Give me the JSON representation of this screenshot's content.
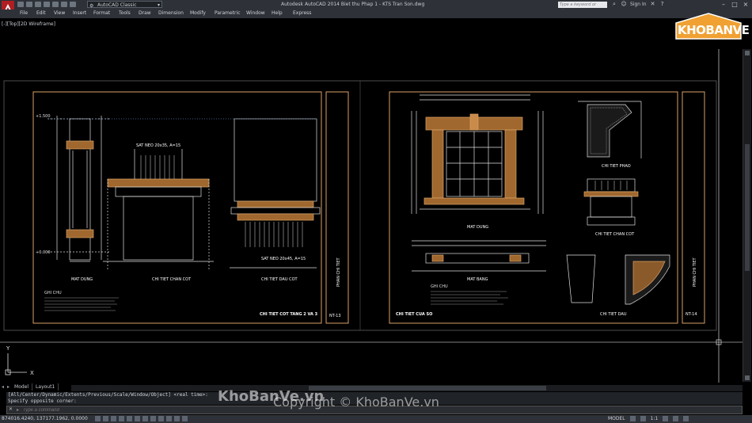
{
  "titlebar": {
    "workspace": "AutoCAD Classic",
    "app_title": "Autodesk AutoCAD 2014    Biet thu Phap 1 - KTS Tran Son.dwg",
    "search_placeholder": "Type a keyword or phrase",
    "sign_in": "Sign In"
  },
  "menu": [
    "File",
    "Edit",
    "View",
    "Insert",
    "Format",
    "Tools",
    "Draw",
    "Dimension",
    "Modify",
    "Parametric",
    "Window",
    "Help",
    "Express"
  ],
  "viewport_label": "[-][Top][2D Wireframe]",
  "drawing": {
    "left_sheet": {
      "labels": {
        "elevation": "MAT DUNG",
        "base_detail": "CHI TIET CHAN COT",
        "capital_detail": "CHI TIET DAU COT",
        "title": "CHI TIET COT TANG 2 VA 3",
        "side_title": "PHAN CHI TIET",
        "sheet_no": "NT-13",
        "note_top": "SAT NEO 20x35, A=15",
        "note_bottom": "SAT NEO 20x45, A=15",
        "level_top": "+1.500",
        "level_bottom": "+0.000",
        "notes_head": "GHI CHU"
      }
    },
    "right_sheet": {
      "labels": {
        "elevation": "MAT DUNG",
        "plan": "MAT BANG",
        "sill_detail": "CHI TIET PHAO",
        "base_detail": "CHI TIET CHAN COT",
        "corbel_detail": "CHI TIET DAU",
        "title": "CHI TIET CUA SO",
        "side_title": "PHAN CHI TIET",
        "sheet_no": "NT-14",
        "notes_head": "GHI CHU"
      }
    }
  },
  "ucs": {
    "y": "Y",
    "x": "X"
  },
  "tabs": [
    "Model",
    "Layout1"
  ],
  "command": {
    "history_1": "[All/Center/Dynamic/Extents/Previous/Scale/Window/Object] <real time>:",
    "history_2": "Specify opposite corner:",
    "placeholder": "Type a command"
  },
  "status": {
    "coords": "874016.4240, 137177.1962, 0.0000",
    "model": "MODEL",
    "scale": "1:1"
  },
  "watermark": {
    "logo": "KHOBANVE",
    "brand": "KhoBanVe.vn",
    "copyright": "Copyright © KhoBanVe.vn"
  },
  "colors": {
    "frame": "#d9a066",
    "drawing": "#e0e0e0",
    "dims": "#c8c8c8",
    "logo": "#f0a132",
    "accent_red": "#b01e23"
  }
}
